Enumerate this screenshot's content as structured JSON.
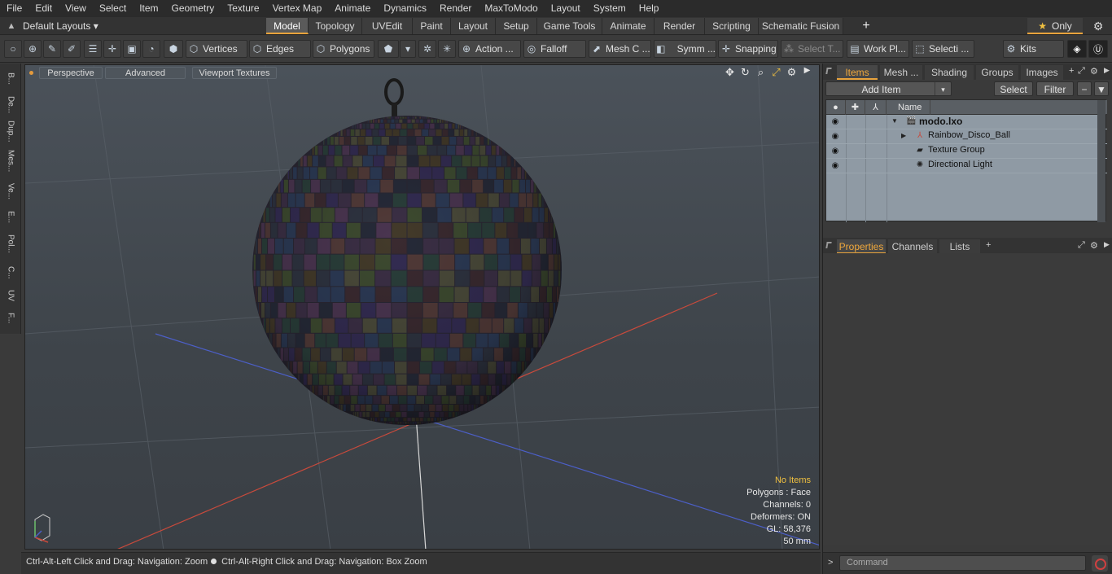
{
  "menu": [
    "File",
    "Edit",
    "View",
    "Select",
    "Item",
    "Geometry",
    "Texture",
    "Vertex Map",
    "Animate",
    "Dynamics",
    "Render",
    "MaxToModo",
    "Layout",
    "System",
    "Help"
  ],
  "layouts": {
    "selector": "Default Layouts ▾",
    "tabs": [
      "Model",
      "Topology",
      "UVEdit",
      "Paint",
      "Layout",
      "Setup",
      "Game Tools",
      "Animate",
      "Render",
      "Scripting",
      "Schematic Fusion"
    ],
    "active_tab": "Model",
    "only_label": "Only"
  },
  "toolbar": {
    "vertices": "Vertices",
    "edges": "Edges",
    "polygons": "Polygons",
    "action": "Action ...",
    "falloff": "Falloff",
    "mesh_constraint": "Mesh C ...",
    "symmetry": "Symm ...",
    "snapping": "Snapping",
    "select_tool": "Select T...",
    "work_plane": "Work Pl...",
    "selection": "Selecti ...",
    "kits": "Kits"
  },
  "left_strip": [
    "B...",
    "De...",
    "Dup...",
    "Mes...",
    "Ve...",
    "E...",
    "Pol...",
    "C...",
    "UV",
    "F..."
  ],
  "viewport": {
    "view_mode": "Perspective",
    "advanced": "Advanced",
    "viewport_textures": "Viewport Textures",
    "info": {
      "selection": "No Items",
      "polygons": "Polygons : Face",
      "channels": "Channels: 0",
      "deformers": "Deformers: ON",
      "gl": "GL: 58,376",
      "focal": "50 mm"
    }
  },
  "status": {
    "hint_left": "Ctrl-Alt-Left Click and Drag: Navigation: Zoom",
    "hint_right": "Ctrl-Alt-Right Click and Drag: Navigation: Box Zoom"
  },
  "items_panel": {
    "tabs": [
      "Items",
      "Mesh ...",
      "Shading",
      "Groups",
      "Images"
    ],
    "active_tab": "Items",
    "add_item": "Add Item",
    "select": "Select",
    "filter": "Filter",
    "name_header": "Name",
    "rows": [
      {
        "name": "modo.lxo",
        "icon": "scene-icon"
      },
      {
        "name": "Rainbow_Disco_Ball",
        "icon": "mesh-icon"
      },
      {
        "name": "Texture Group",
        "icon": "texture-group-icon"
      },
      {
        "name": "Directional Light",
        "icon": "light-icon"
      }
    ]
  },
  "properties_panel": {
    "tabs": [
      "Properties",
      "Channels",
      "Lists"
    ],
    "active_tab": "Properties"
  },
  "command": {
    "placeholder": "Command"
  },
  "colors": {
    "accent": "#e8a33c",
    "warning_text": "#f0c040",
    "x_axis": "#c84a3c",
    "z_axis": "#4c5fc8"
  }
}
